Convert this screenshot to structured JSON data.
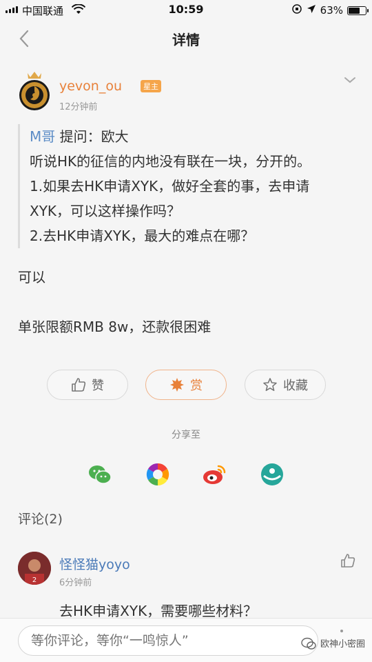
{
  "status_bar": {
    "carrier": "中国联通",
    "time": "10:59",
    "battery": "63%"
  },
  "nav": {
    "title": "详情"
  },
  "post": {
    "author": "yevon_ou",
    "badge": "星主",
    "time": "12分钟前",
    "quote": {
      "asker": "M哥",
      "line1_rest": " 提问：欧大",
      "line2": "听说HK的征信的内地没有联在一块，分开的。",
      "line3": "1.如果去HK申请XYK，做好全套的事，去申请",
      "line4": "XYK，可以这样操作吗？",
      "line5": "2.去HK申请XYK，最大的难点在哪？"
    },
    "answer_line1": "可以",
    "answer_line2": "单张限额RMB 8w，还款很困难"
  },
  "actions": {
    "like": "赞",
    "reward": "赏",
    "collect": "收藏"
  },
  "share": {
    "label": "分享至"
  },
  "comments": {
    "title": "评论(2)",
    "items": [
      {
        "name": "怪怪猫yoyo",
        "time": "6分钟前",
        "text": "去HK申请XYK，需要哪些材料？"
      }
    ]
  },
  "bottom": {
    "input_placeholder": "等你评论，等你“一鸣惊人”",
    "watermark": "欧神小密圈"
  },
  "colors": {
    "accent_orange": "#e8813a",
    "link_blue": "#4a7ab8"
  }
}
